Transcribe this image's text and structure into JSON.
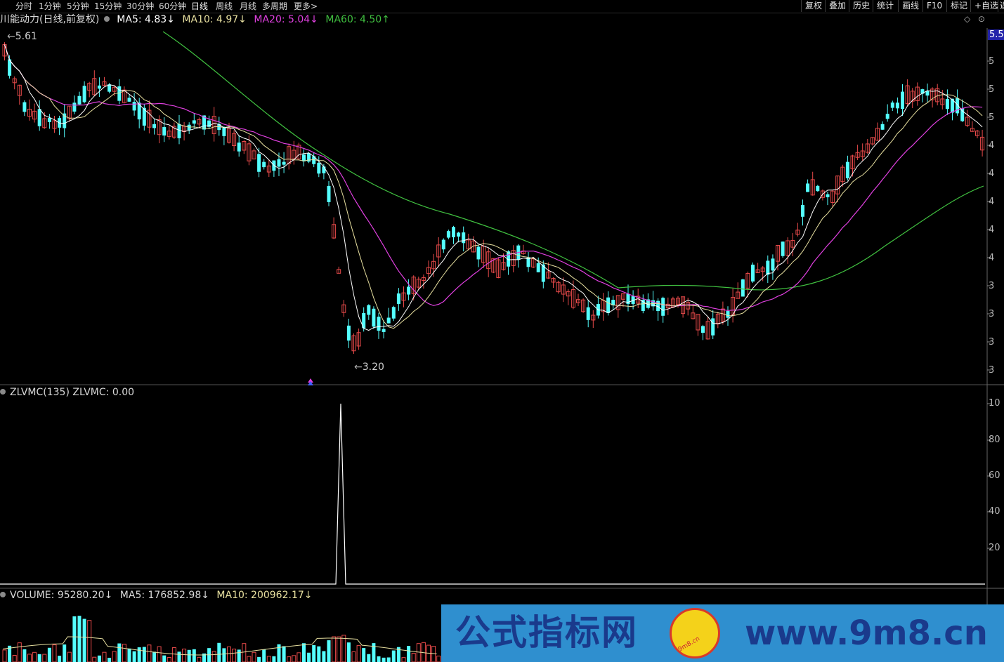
{
  "toolbar": {
    "timeframes": [
      "分时",
      "1分钟",
      "5分钟",
      "15分钟",
      "30分钟",
      "60分钟",
      "日线",
      "周线",
      "月线",
      "多周期",
      "更多>"
    ],
    "active": "日线",
    "right_buttons": [
      "复权",
      "叠加",
      "历史",
      "统计",
      "画线",
      "F10",
      "标记",
      "+自选",
      "返"
    ]
  },
  "main_chart": {
    "stock_name": "川能动力(日线,前复权)",
    "ma5": "MA5: 4.83↓",
    "ma10": "MA10: 4.97↓",
    "ma20": "MA20: 5.04↓",
    "ma60": "MA60: 4.50↑",
    "high_label": "5.61",
    "low_label": "3.20",
    "price_badge": "5.5",
    "axis_labels": [
      "5",
      "5",
      "5",
      "4",
      "4",
      "4",
      "4",
      "4",
      "3",
      "3",
      "3",
      "3",
      "3"
    ]
  },
  "indicator": {
    "title": "ZLVMC(135) ZLVMC: 0.00",
    "axis_labels": [
      "10",
      "80",
      "60",
      "40",
      "20"
    ]
  },
  "volume": {
    "label": "VOLUME: 95280.20↓",
    "ma5": "MA5: 176852.98↓",
    "ma10": "MA10: 200962.17↓"
  },
  "watermark": {
    "text_cn": "公式指标网",
    "url": "www.9m8.cn",
    "logo_text": "9m8.cn"
  },
  "colors": {
    "up": "#e84a4a",
    "down": "#54ffff",
    "ma5": "#ffffff",
    "ma10": "#e8e0a0",
    "ma20": "#e040e0",
    "ma60": "#40c040",
    "background": "#000000",
    "watermark_bg": "#2f8fcf",
    "watermark_text": "#1a3a8c"
  }
}
